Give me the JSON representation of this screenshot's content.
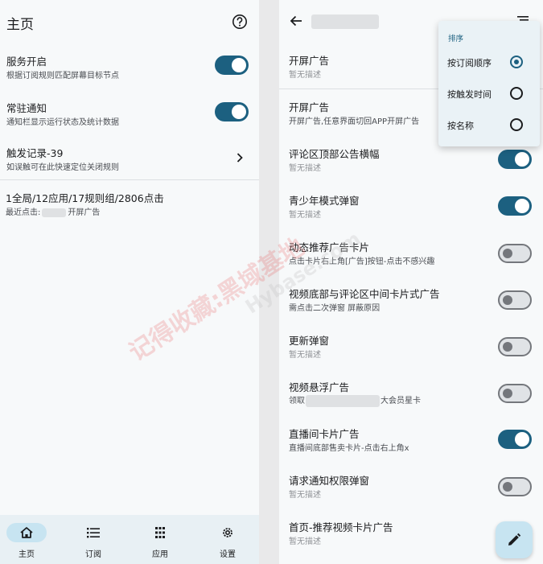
{
  "left": {
    "title": "主页",
    "settings": [
      {
        "title": "服务开启",
        "desc": "根据订阅规则匹配屏幕目标节点",
        "on": true
      },
      {
        "title": "常驻通知",
        "desc": "通知栏显示运行状态及统计数据",
        "on": true
      }
    ],
    "log": {
      "title": "触发记录-39",
      "desc": "如误触可在此快速定位关闭规则"
    },
    "stats": {
      "summary": "1全局/12应用/17规则组/2806点击",
      "last_prefix": "最近点击:",
      "last_suffix": "开屏广告"
    },
    "nav": [
      {
        "label": "主页",
        "icon": "home-icon"
      },
      {
        "label": "订阅",
        "icon": "list-icon"
      },
      {
        "label": "应用",
        "icon": "apps-grid-icon"
      },
      {
        "label": "设置",
        "icon": "gear-icon"
      }
    ]
  },
  "right": {
    "rules": [
      {
        "title": "开屏广告",
        "desc": "暂无描述",
        "on": null
      },
      {
        "title": "开屏广告",
        "desc": "开屏广告,任意界面切回APP开屏广告",
        "on": null
      },
      {
        "title": "评论区顶部公告横幅",
        "desc": "暂无描述",
        "on": true
      },
      {
        "title": "青少年模式弹窗",
        "desc": "暂无描述",
        "on": true
      },
      {
        "title": "动态推荐广告卡片",
        "desc": "点击卡片右上角[广告]按钮-点击不感兴趣",
        "on": false
      },
      {
        "title": "视频底部与评论区中间卡片式广告",
        "desc": "需点击二次弹窗 屏蔽原因",
        "on": false
      },
      {
        "title": "更新弹窗",
        "desc": "暂无描述",
        "on": false
      },
      {
        "title": "视频悬浮广告",
        "desc_prefix": "领取",
        "desc_suffix": "大会员星卡",
        "on": false
      },
      {
        "title": "直播间卡片广告",
        "desc": "直播间底部售卖卡片-点击右上角x",
        "on": true
      },
      {
        "title": "请求通知权限弹窗",
        "desc": "暂无描述",
        "on": false
      },
      {
        "title": "首页-推荐视频卡片广告",
        "desc": "暂无描述",
        "on": null
      }
    ],
    "sort_menu": {
      "header": "排序",
      "options": [
        "按订阅顺序",
        "按触发时间",
        "按名称"
      ],
      "selected": 0
    }
  },
  "watermark": {
    "text": "记得收藏:黑域基地",
    "text2": "Hybase.com"
  },
  "colors": {
    "accent": "#1c6080",
    "switch_off": "#e0e3e6",
    "nav_bg": "#e8f0f4",
    "pill": "#c7e4f1"
  }
}
